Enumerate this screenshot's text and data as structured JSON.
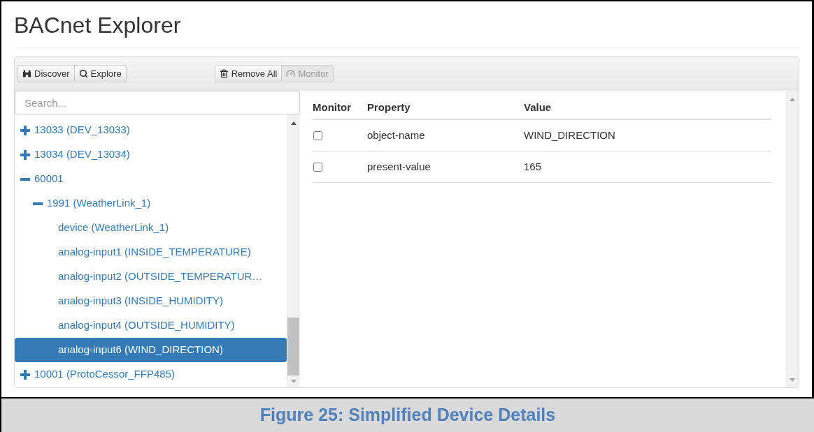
{
  "title": "BACnet Explorer",
  "toolbar": {
    "left": [
      {
        "label": "Discover",
        "kind": "binoculars",
        "disabled": false
      },
      {
        "label": "Explore",
        "kind": "search",
        "disabled": false
      }
    ],
    "right": [
      {
        "label": "Remove All",
        "kind": "trash",
        "disabled": false
      },
      {
        "label": "Monitor",
        "kind": "gauge",
        "disabled": true
      }
    ]
  },
  "search": {
    "placeholder": "Search..."
  },
  "tree": [
    {
      "label": "13033 (DEV_13033)",
      "expanded": false,
      "selected": false
    },
    {
      "label": "13034 (DEV_13034)",
      "expanded": false,
      "selected": false
    },
    {
      "label": "60001",
      "expanded": true,
      "selected": false,
      "children": [
        {
          "label": "1991 (WeatherLink_1)",
          "expanded": true,
          "selected": false,
          "children": [
            {
              "label": "device (WeatherLink_1)",
              "selected": false
            },
            {
              "label": "analog-input1 (INSIDE_TEMPERATURE)",
              "selected": false
            },
            {
              "label": "analog-input2 (OUTSIDE_TEMPERATUR…",
              "selected": false
            },
            {
              "label": "analog-input3 (INSIDE_HUMIDITY)",
              "selected": false
            },
            {
              "label": "analog-input4 (OUTSIDE_HUMIDITY)",
              "selected": false
            },
            {
              "label": "analog-input6 (WIND_DIRECTION)",
              "selected": true
            }
          ]
        }
      ]
    },
    {
      "label": "10001 (ProtoCessor_FFP485)",
      "expanded": false,
      "selected": false
    }
  ],
  "table": {
    "columns": [
      "Monitor",
      "Property",
      "Value"
    ],
    "rows": [
      {
        "monitor": false,
        "property": "object-name",
        "value": "WIND_DIRECTION"
      },
      {
        "monitor": false,
        "property": "present-value",
        "value": "165"
      }
    ]
  },
  "caption": "Figure 25: Simplified Device Details"
}
